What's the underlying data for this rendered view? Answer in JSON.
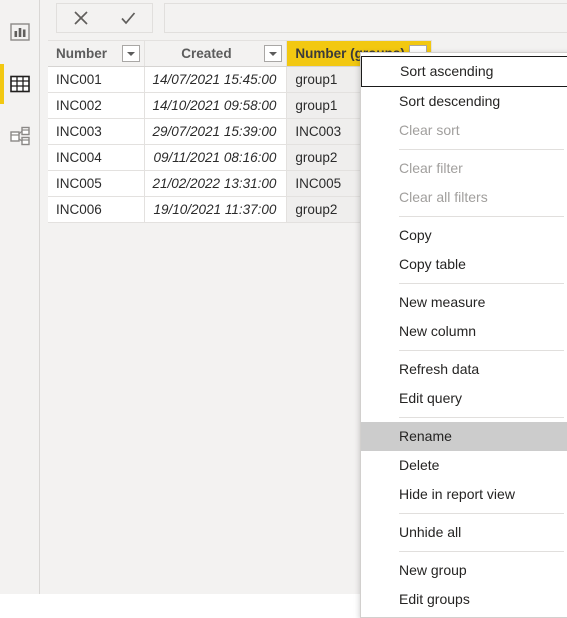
{
  "app": {
    "name": "power-bi-desktop-data-view",
    "accent_color": "#f2c811",
    "header_selected_color": "#f2c811",
    "menu_hover_color": "#cccccc"
  },
  "sidebar": {
    "items": [
      {
        "name": "report-view",
        "icon": "bar-chart-icon",
        "label": "Report",
        "selected": false
      },
      {
        "name": "data-view",
        "icon": "table-icon",
        "label": "Data",
        "selected": true
      },
      {
        "name": "model-view",
        "icon": "model-relationship-icon",
        "label": "Model",
        "selected": false
      }
    ]
  },
  "command_bar": {
    "cancel_label": "Cancel",
    "cancel_icon": "close-x-icon",
    "confirm_label": "Confirm",
    "confirm_icon": "checkmark-icon"
  },
  "grid": {
    "columns": [
      {
        "header": "Number",
        "has_filter_button": true,
        "selected": false,
        "align": "left"
      },
      {
        "header": "Created",
        "has_filter_button": true,
        "selected": false,
        "align": "center"
      },
      {
        "header": "Number (groups)",
        "has_filter_button": true,
        "selected": true,
        "align": "left"
      }
    ],
    "rows": [
      {
        "number": "INC001",
        "created": "14/07/2021 15:45:00",
        "number_groups": "group1"
      },
      {
        "number": "INC002",
        "created": "14/10/2021 09:58:00",
        "number_groups": "group1"
      },
      {
        "number": "INC003",
        "created": "29/07/2021 15:39:00",
        "number_groups": "INC003"
      },
      {
        "number": "INC004",
        "created": "09/11/2021 08:16:00",
        "number_groups": "group2"
      },
      {
        "number": "INC005",
        "created": "21/02/2022 13:31:00",
        "number_groups": "INC005"
      },
      {
        "number": "INC006",
        "created": "19/10/2021 11:37:00",
        "number_groups": "group2"
      }
    ]
  },
  "context_menu": {
    "items": [
      {
        "label": "Sort ascending",
        "name": "menu-sort-ascending",
        "disabled": false,
        "state": "focused"
      },
      {
        "label": "Sort descending",
        "name": "menu-sort-descending",
        "disabled": false,
        "state": "normal"
      },
      {
        "label": "Clear sort",
        "name": "menu-clear-sort",
        "disabled": true,
        "state": "normal"
      },
      {
        "separator": true
      },
      {
        "label": "Clear filter",
        "name": "menu-clear-filter",
        "disabled": true,
        "state": "normal"
      },
      {
        "label": "Clear all filters",
        "name": "menu-clear-all-filters",
        "disabled": true,
        "state": "normal"
      },
      {
        "separator": true
      },
      {
        "label": "Copy",
        "name": "menu-copy",
        "disabled": false,
        "state": "normal"
      },
      {
        "label": "Copy table",
        "name": "menu-copy-table",
        "disabled": false,
        "state": "normal"
      },
      {
        "separator": true
      },
      {
        "label": "New measure",
        "name": "menu-new-measure",
        "disabled": false,
        "state": "normal"
      },
      {
        "label": "New column",
        "name": "menu-new-column",
        "disabled": false,
        "state": "normal"
      },
      {
        "separator": true
      },
      {
        "label": "Refresh data",
        "name": "menu-refresh-data",
        "disabled": false,
        "state": "normal"
      },
      {
        "label": "Edit query",
        "name": "menu-edit-query",
        "disabled": false,
        "state": "normal"
      },
      {
        "separator": true
      },
      {
        "label": "Rename",
        "name": "menu-rename",
        "disabled": false,
        "state": "hovered"
      },
      {
        "label": "Delete",
        "name": "menu-delete",
        "disabled": false,
        "state": "normal"
      },
      {
        "label": "Hide in report view",
        "name": "menu-hide-in-report-view",
        "disabled": false,
        "state": "normal"
      },
      {
        "separator": true
      },
      {
        "label": "Unhide all",
        "name": "menu-unhide-all",
        "disabled": false,
        "state": "normal"
      },
      {
        "separator": true
      },
      {
        "label": "New group",
        "name": "menu-new-group",
        "disabled": false,
        "state": "normal"
      },
      {
        "label": "Edit groups",
        "name": "menu-edit-groups",
        "disabled": false,
        "state": "normal"
      }
    ]
  }
}
